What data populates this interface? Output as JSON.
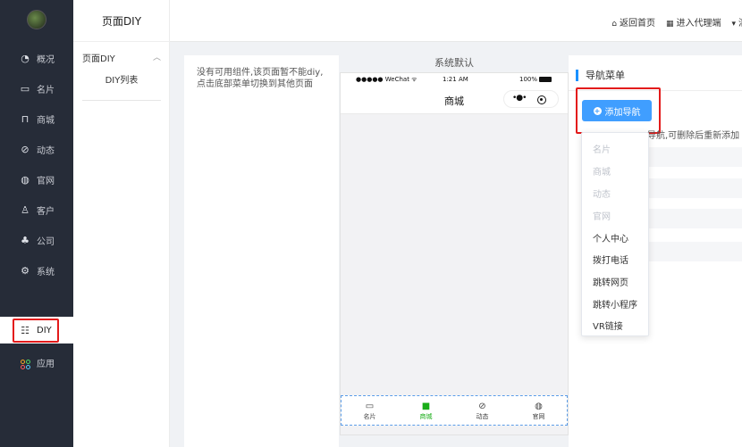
{
  "sidebar": {
    "items": [
      {
        "label": "概况",
        "icon": "dashboard-icon",
        "glyph": "◔"
      },
      {
        "label": "名片",
        "icon": "card-icon",
        "glyph": "▭"
      },
      {
        "label": "商城",
        "icon": "shop-bag-icon",
        "glyph": "⊓"
      },
      {
        "label": "动态",
        "icon": "compass-icon",
        "glyph": "⊘"
      },
      {
        "label": "官网",
        "icon": "globe-icon",
        "glyph": "◍"
      },
      {
        "label": "客户",
        "icon": "user-icon",
        "glyph": "♙"
      },
      {
        "label": "公司",
        "icon": "org-icon",
        "glyph": "♣"
      },
      {
        "label": "系统",
        "icon": "gear-icon",
        "glyph": "⚙"
      }
    ],
    "diy_label": "DIY",
    "app_label": "应用"
  },
  "submenu": {
    "title": "页面DIY",
    "group_label": "页面DIY",
    "sub_label": "DIY列表"
  },
  "topbar": {
    "links": [
      {
        "label": "返回首页",
        "icon": "home-icon",
        "glyph": "⌂"
      },
      {
        "label": "进入代理端",
        "icon": "grid-icon",
        "glyph": "▦"
      },
      {
        "label": "清",
        "icon": "funnel-icon",
        "glyph": "▾"
      }
    ]
  },
  "component_panel": {
    "message": "没有可用组件,该页面暂不能diy,点击底部菜单切换到其他页面"
  },
  "preview": {
    "title": "系统默认",
    "status_left": "●●●●● WeChat ᯤ",
    "status_time": "1:21 AM",
    "status_battery": "100%",
    "nav_title": "商城",
    "capsule_dots": "•●•",
    "tabs": [
      {
        "label": "名片",
        "icon": "card-tab-icon",
        "glyph": "▭",
        "active": false
      },
      {
        "label": "商城",
        "icon": "shop-tab-icon",
        "glyph": "■",
        "active": true
      },
      {
        "label": "动态",
        "icon": "compass-tab-icon",
        "glyph": "⊘",
        "active": false
      },
      {
        "label": "官网",
        "icon": "globe-tab-icon",
        "glyph": "◍",
        "active": false
      }
    ],
    "active_color": "#1aad19"
  },
  "settings": {
    "title": "导航菜单",
    "add_button": "添加导航",
    "hint": "导航,可删除后重新添加",
    "accent": "#409eff"
  },
  "dropdown": {
    "items": [
      {
        "label": "名片",
        "disabled": true
      },
      {
        "label": "商城",
        "disabled": true
      },
      {
        "label": "动态",
        "disabled": true
      },
      {
        "label": "官网",
        "disabled": true
      },
      {
        "label": "个人中心",
        "disabled": false
      },
      {
        "label": "拨打电话",
        "disabled": false
      },
      {
        "label": "跳转网页",
        "disabled": false
      },
      {
        "label": "跳转小程序",
        "disabled": false
      },
      {
        "label": "VR链接",
        "disabled": false
      }
    ]
  }
}
